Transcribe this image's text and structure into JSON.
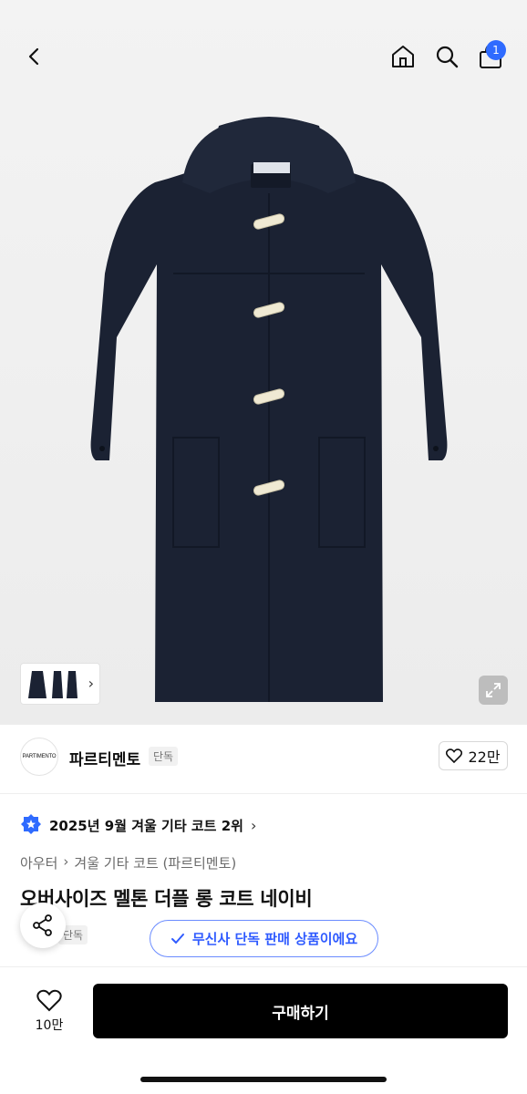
{
  "header": {
    "cart_count": "1"
  },
  "brand": {
    "logo_text": "PARTIMENTO",
    "name": "파르티멘토",
    "tag": "단독",
    "likes": "22만"
  },
  "ranking": {
    "text": "2025년 9월 겨울 기타 코트 2위"
  },
  "breadcrumb": {
    "items": [
      "아우터",
      "겨울 기타 코트 (파르티멘토)"
    ]
  },
  "product": {
    "title": "오버사이즈 멜톤 더플 롱 코트 네이비",
    "tag": "단독",
    "exclusive_toast": "무신사 단독 판매 상품이에요"
  },
  "bottom": {
    "wishlist_count": "10만",
    "buy_label": "구매하기"
  },
  "colors": {
    "accent_blue": "#2f6bff",
    "coat_navy": "#1b2233",
    "toggle_cream": "#efe9d3"
  }
}
